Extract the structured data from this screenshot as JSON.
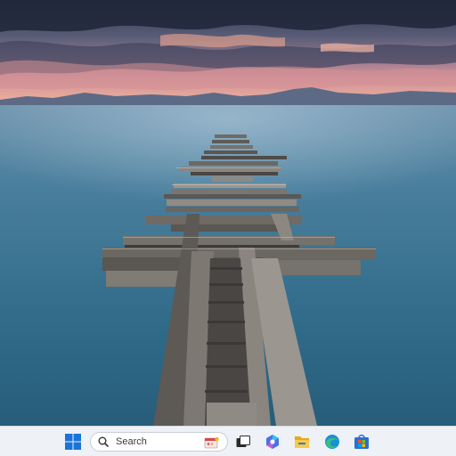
{
  "desktop": {
    "wallpaper": "dock-pier-lake-sunset",
    "colors": {
      "sky_top": "#2a3348",
      "sunset": "#f2a48e",
      "water": "#2f6a88",
      "wood": "#6e6a64"
    }
  },
  "taskbar": {
    "background": "#eef1f6",
    "search": {
      "label": "Search"
    },
    "icons": [
      "windows-start-icon",
      "search-icon",
      "task-view-icon",
      "copilot-icon",
      "file-explorer-icon",
      "edge-browser-icon",
      "microsoft-store-icon"
    ]
  }
}
